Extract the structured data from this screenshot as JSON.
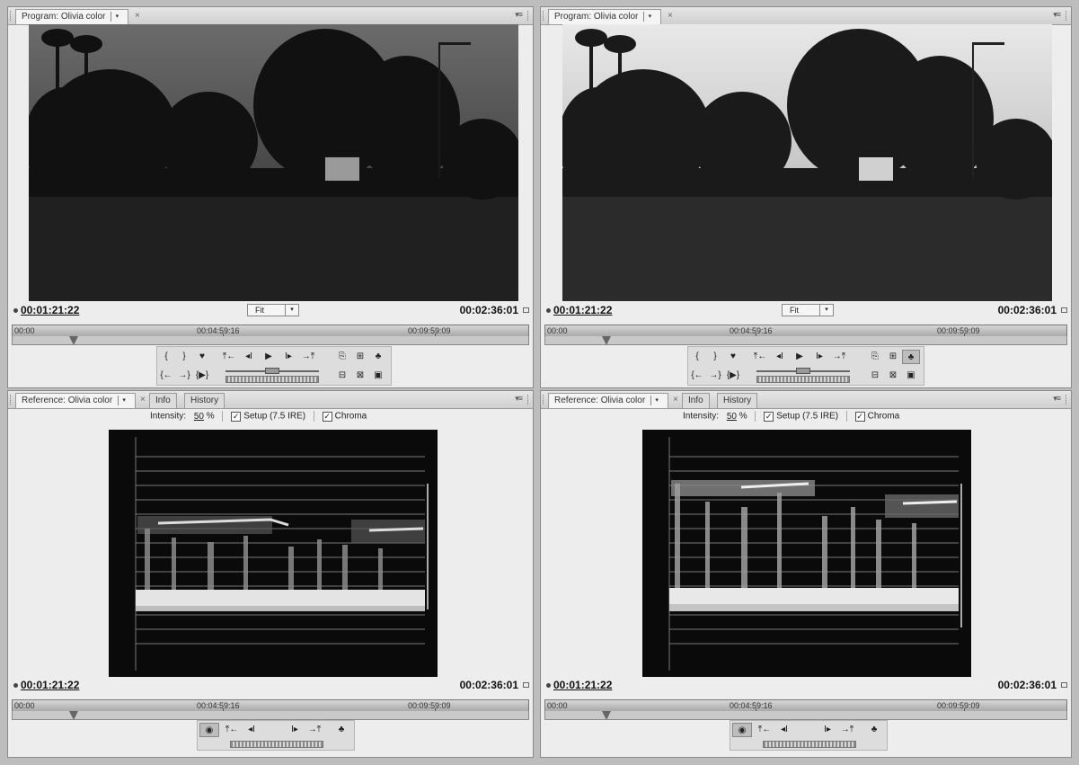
{
  "panels": {
    "program_left": {
      "tab_label": "Program: Olivia color",
      "current_tc": "00:01:21:22",
      "duration_tc": "00:02:36:01",
      "zoom": "Fit"
    },
    "program_right": {
      "tab_label": "Program: Olivia color",
      "current_tc": "00:01:21:22",
      "duration_tc": "00:02:36:01",
      "zoom": "Fit"
    },
    "reference_left": {
      "tab_label": "Reference: Olivia color",
      "current_tc": "00:01:21:22",
      "duration_tc": "00:02:36:01"
    },
    "reference_right": {
      "tab_label": "Reference: Olivia color",
      "current_tc": "00:01:21:22",
      "duration_tc": "00:02:36:01"
    }
  },
  "tabs": {
    "info": "Info",
    "history": "History"
  },
  "ruler": {
    "start": "00:00",
    "mid": "00:04:59:16",
    "end": "00:09:59:09"
  },
  "scope_options": {
    "intensity_label": "Intensity:",
    "intensity_value": "50",
    "intensity_unit": "%",
    "setup_label": "Setup (7.5 IRE)",
    "chroma_label": "Chroma"
  },
  "icons": {
    "dropdown": "▾",
    "close": "×",
    "panel_menu": "▾≡",
    "check": "✓"
  },
  "controls": {
    "mark_in": "{",
    "mark_out": "}",
    "marker": "♥",
    "goto_in": "⤒←",
    "step_back": "◂I",
    "play": "▶",
    "step_fwd": "I▸",
    "goto_out": "→⤒",
    "lift": "⎘",
    "extract": "⊞",
    "export": "♣",
    "clear_in": "{←",
    "clear_out": "→}",
    "play_in_out": "{▶}",
    "trim": "⊟",
    "overlay": "⊠",
    "camera": "▣",
    "output": "◉"
  }
}
